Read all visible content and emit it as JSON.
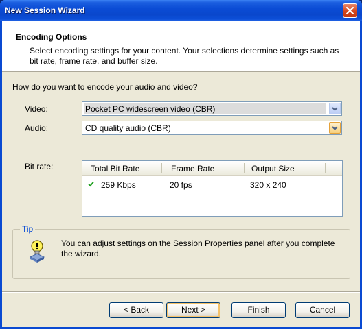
{
  "window": {
    "title": "New Session Wizard"
  },
  "header": {
    "title": "Encoding Options",
    "description": "Select encoding settings for your content. Your selections determine settings such as bit rate, frame rate, and buffer size."
  },
  "question": "How do you want to encode your audio and video?",
  "video": {
    "label": "Video:",
    "value": "Pocket PC widescreen video (CBR)"
  },
  "audio": {
    "label": "Audio:",
    "value": "CD quality audio (CBR)"
  },
  "bitrate": {
    "label": "Bit rate:",
    "columns": [
      "Total Bit Rate",
      "Frame Rate",
      "Output Size"
    ],
    "rows": [
      {
        "checked": true,
        "total_bit_rate": "259 Kbps",
        "frame_rate": "20 fps",
        "output_size": "320 x 240"
      }
    ]
  },
  "tip": {
    "label": "Tip",
    "text": "You can adjust settings on the Session Properties panel after you complete the wizard.",
    "icon": "lightbulb-icon"
  },
  "buttons": {
    "back": "< Back",
    "next": "Next >",
    "finish": "Finish",
    "cancel": "Cancel"
  },
  "colors": {
    "title_bar": "#0a4ad2",
    "client_bg": "#ece9d8",
    "tip_label": "#0046d5",
    "close_button": "#d3451c"
  }
}
